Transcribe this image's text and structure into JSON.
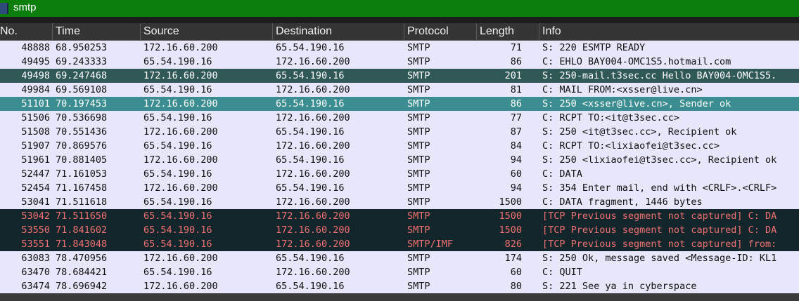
{
  "filter": {
    "text": "smtp"
  },
  "columns": [
    "No.",
    "Time",
    "Source",
    "Destination",
    "Protocol",
    "Length",
    "Info"
  ],
  "colors": {
    "normal_bg": "#e7e6fb",
    "normal_fg": "#111111",
    "dark_bg": "#2f5857",
    "dark_fg": "#ffffff",
    "teal_bg": "#3c8d91",
    "teal_fg": "#ffffff",
    "error_bg": "#13262b",
    "error_fg": "#ef7070"
  },
  "packets": [
    {
      "no": "48888",
      "time": "68.950253",
      "src": "172.16.60.200",
      "dst": "65.54.190.16",
      "proto": "SMTP",
      "len": "71",
      "info": "S: 220 ESMTP READY",
      "style": "normal"
    },
    {
      "no": "49495",
      "time": "69.243333",
      "src": "65.54.190.16",
      "dst": "172.16.60.200",
      "proto": "SMTP",
      "len": "86",
      "info": "C: EHLO BAY004-OMC1S5.hotmail.com",
      "style": "normal"
    },
    {
      "no": "49498",
      "time": "69.247468",
      "src": "172.16.60.200",
      "dst": "65.54.190.16",
      "proto": "SMTP",
      "len": "201",
      "info": "S: 250-mail.t3sec.cc Hello BAY004-OMC1S5.",
      "style": "dark"
    },
    {
      "no": "49984",
      "time": "69.569108",
      "src": "65.54.190.16",
      "dst": "172.16.60.200",
      "proto": "SMTP",
      "len": "81",
      "info": "C: MAIL FROM:<xsser@live.cn>",
      "style": "normal"
    },
    {
      "no": "51101",
      "time": "70.197453",
      "src": "172.16.60.200",
      "dst": "65.54.190.16",
      "proto": "SMTP",
      "len": "86",
      "info": "S: 250 <xsser@live.cn>, Sender ok",
      "style": "teal"
    },
    {
      "no": "51506",
      "time": "70.536698",
      "src": "65.54.190.16",
      "dst": "172.16.60.200",
      "proto": "SMTP",
      "len": "77",
      "info": "C: RCPT TO:<it@t3sec.cc>",
      "style": "normal"
    },
    {
      "no": "51508",
      "time": "70.551436",
      "src": "172.16.60.200",
      "dst": "65.54.190.16",
      "proto": "SMTP",
      "len": "87",
      "info": "S: 250 <it@t3sec.cc>, Recipient ok",
      "style": "normal"
    },
    {
      "no": "51907",
      "time": "70.869576",
      "src": "65.54.190.16",
      "dst": "172.16.60.200",
      "proto": "SMTP",
      "len": "84",
      "info": "C: RCPT TO:<lixiaofei@t3sec.cc>",
      "style": "normal"
    },
    {
      "no": "51961",
      "time": "70.881405",
      "src": "172.16.60.200",
      "dst": "65.54.190.16",
      "proto": "SMTP",
      "len": "94",
      "info": "S: 250 <lixiaofei@t3sec.cc>, Recipient ok",
      "style": "normal"
    },
    {
      "no": "52447",
      "time": "71.161053",
      "src": "65.54.190.16",
      "dst": "172.16.60.200",
      "proto": "SMTP",
      "len": "60",
      "info": "C: DATA",
      "style": "normal"
    },
    {
      "no": "52454",
      "time": "71.167458",
      "src": "172.16.60.200",
      "dst": "65.54.190.16",
      "proto": "SMTP",
      "len": "94",
      "info": "S: 354 Enter mail, end with <CRLF>.<CRLF>",
      "style": "normal"
    },
    {
      "no": "53041",
      "time": "71.511618",
      "src": "65.54.190.16",
      "dst": "172.16.60.200",
      "proto": "SMTP",
      "len": "1500",
      "info": "C: DATA fragment, 1446 bytes",
      "style": "normal"
    },
    {
      "no": "53042",
      "time": "71.511650",
      "src": "65.54.190.16",
      "dst": "172.16.60.200",
      "proto": "SMTP",
      "len": "1500",
      "info": "[TCP Previous segment not captured] C: DA",
      "style": "error"
    },
    {
      "no": "53550",
      "time": "71.841602",
      "src": "65.54.190.16",
      "dst": "172.16.60.200",
      "proto": "SMTP",
      "len": "1500",
      "info": "[TCP Previous segment not captured] C: DA",
      "style": "error"
    },
    {
      "no": "53551",
      "time": "71.843048",
      "src": "65.54.190.16",
      "dst": "172.16.60.200",
      "proto": "SMTP/IMF",
      "len": "826",
      "info": "[TCP Previous segment not captured] from:",
      "style": "error"
    },
    {
      "no": "63083",
      "time": "78.470956",
      "src": "172.16.60.200",
      "dst": "65.54.190.16",
      "proto": "SMTP",
      "len": "174",
      "info": "S: 250 Ok, message saved <Message-ID: KL1",
      "style": "normal"
    },
    {
      "no": "63470",
      "time": "78.684421",
      "src": "65.54.190.16",
      "dst": "172.16.60.200",
      "proto": "SMTP",
      "len": "60",
      "info": "C: QUIT",
      "style": "normal"
    },
    {
      "no": "63474",
      "time": "78.696942",
      "src": "172.16.60.200",
      "dst": "65.54.190.16",
      "proto": "SMTP",
      "len": "80",
      "info": "S: 221 See ya in cyberspace",
      "style": "normal"
    }
  ]
}
